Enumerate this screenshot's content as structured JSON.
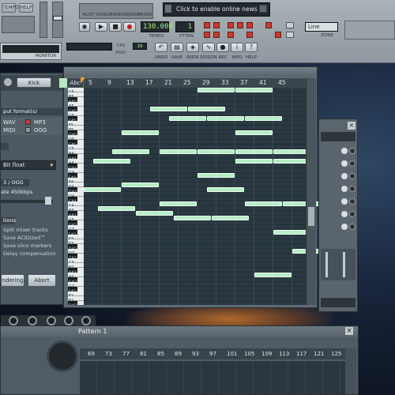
{
  "toolbar": {
    "left_menu": [
      "TEMPO",
      "HELP"
    ],
    "views": [
      "PLIST",
      "SONGR",
      "PIANO",
      "BRWSR",
      "MIXER"
    ],
    "news_text": "Click to enable online news",
    "tempo_value": "130.000",
    "tempo_label": "TEMPO",
    "pattern_label": "PTTRN",
    "pattern_value": "1",
    "snap_value": "Line",
    "snap_sub": "ZONE",
    "cpu_label": "CPU",
    "poly_label": "POLY",
    "poly_value": "16",
    "tools": [
      "UNDO",
      "SAVE",
      "RNDR",
      "EDISON",
      "REC",
      "INFO",
      "HELP"
    ],
    "recording_label": "RECORD",
    "monitor_label": "MONITOR"
  },
  "render_panel": {
    "start_button": "Kick",
    "output_header": "put format(s)",
    "formats": [
      {
        "label": "WAV",
        "checked": false
      },
      {
        "label": "MP3",
        "checked": true
      },
      {
        "label": "MIDI",
        "checked": false
      },
      {
        "label": "OGG",
        "checked": false
      }
    ],
    "depth_value": "Bit float",
    "mp3_header": "3 / OGG",
    "bitrate_text": "ate 450kbps",
    "options_header": "tions",
    "options": [
      "Split mixer tracks",
      "Save ACIDized™",
      "Save slice markers",
      "Delay compensation"
    ],
    "render_button": "ndering",
    "abort_button": "Abort"
  },
  "piano_roll": {
    "ruler": [
      "5",
      "9",
      "13",
      "17",
      "21",
      "25",
      "29",
      "33",
      "37",
      "41",
      "45"
    ],
    "keys": [
      {
        "label": "C6",
        "black": false
      },
      {
        "label": "B5",
        "black": false
      },
      {
        "label": "A#5",
        "black": true
      },
      {
        "label": "A5",
        "black": false
      },
      {
        "label": "G#5",
        "black": true
      },
      {
        "label": "G5",
        "black": false
      },
      {
        "label": "F#5",
        "black": true
      },
      {
        "label": "F5",
        "black": false
      },
      {
        "label": "E5",
        "black": false
      },
      {
        "label": "D#5",
        "black": true
      },
      {
        "label": "D5",
        "black": false
      },
      {
        "label": "C#5",
        "black": true
      },
      {
        "label": "C5",
        "black": false
      },
      {
        "label": "B4",
        "black": false
      },
      {
        "label": "A#4",
        "black": true
      },
      {
        "label": "A4",
        "black": false
      },
      {
        "label": "G#4",
        "black": true
      },
      {
        "label": "G4",
        "black": false
      },
      {
        "label": "F#4",
        "black": true
      },
      {
        "label": "F4",
        "black": false
      },
      {
        "label": "E4",
        "black": false
      },
      {
        "label": "D#4",
        "black": true
      },
      {
        "label": "D4",
        "black": false
      },
      {
        "label": "C#4",
        "black": true
      },
      {
        "label": "C4",
        "black": false
      },
      {
        "label": "B3",
        "black": false
      },
      {
        "label": "A#3",
        "black": true
      },
      {
        "label": "A3",
        "black": false
      },
      {
        "label": "G#3",
        "black": true
      },
      {
        "label": "G3",
        "black": false
      },
      {
        "label": "F#3",
        "black": true
      },
      {
        "label": "F3",
        "black": false
      },
      {
        "label": "E3",
        "black": false
      },
      {
        "label": "D#3",
        "black": true
      },
      {
        "label": "D3",
        "black": false
      },
      {
        "label": "C#3",
        "black": true
      },
      {
        "label": "C3",
        "black": false
      },
      {
        "label": "B2",
        "black": false
      },
      {
        "label": "A#2",
        "black": true
      },
      {
        "label": "A2",
        "black": false
      },
      {
        "label": "G#2",
        "black": true
      },
      {
        "label": "G2",
        "black": false
      },
      {
        "label": "F#2",
        "black": true
      },
      {
        "label": "F2",
        "black": false
      },
      {
        "label": "E2",
        "black": false
      },
      {
        "label": "D#2",
        "black": true
      }
    ],
    "notes": [
      {
        "row": 0,
        "start": 24,
        "len": 8
      },
      {
        "row": 0,
        "start": 32,
        "len": 8
      },
      {
        "row": 4,
        "start": 14,
        "len": 8
      },
      {
        "row": 4,
        "start": 22,
        "len": 8
      },
      {
        "row": 6,
        "start": 18,
        "len": 8
      },
      {
        "row": 6,
        "start": 26,
        "len": 8
      },
      {
        "row": 6,
        "start": 34,
        "len": 8
      },
      {
        "row": 9,
        "start": 8,
        "len": 8
      },
      {
        "row": 9,
        "start": 32,
        "len": 8
      },
      {
        "row": 13,
        "start": 6,
        "len": 8
      },
      {
        "row": 13,
        "start": 16,
        "len": 8
      },
      {
        "row": 13,
        "start": 24,
        "len": 8
      },
      {
        "row": 13,
        "start": 32,
        "len": 8
      },
      {
        "row": 13,
        "start": 40,
        "len": 8
      },
      {
        "row": 15,
        "start": 2,
        "len": 8
      },
      {
        "row": 15,
        "start": 32,
        "len": 8
      },
      {
        "row": 15,
        "start": 40,
        "len": 8
      },
      {
        "row": 18,
        "start": 24,
        "len": 8
      },
      {
        "row": 20,
        "start": 8,
        "len": 8
      },
      {
        "row": 21,
        "start": 0,
        "len": 8
      },
      {
        "row": 21,
        "start": 26,
        "len": 8
      },
      {
        "row": 24,
        "start": 16,
        "len": 8
      },
      {
        "row": 24,
        "start": 34,
        "len": 8
      },
      {
        "row": 24,
        "start": 42,
        "len": 8
      },
      {
        "row": 25,
        "start": 3,
        "len": 8
      },
      {
        "row": 26,
        "start": 11,
        "len": 8
      },
      {
        "row": 27,
        "start": 19,
        "len": 8
      },
      {
        "row": 27,
        "start": 27,
        "len": 8
      },
      {
        "row": 30,
        "start": 40,
        "len": 8
      },
      {
        "row": 34,
        "start": 44,
        "len": 6
      },
      {
        "row": 39,
        "start": 36,
        "len": 8
      }
    ]
  },
  "playlist": {
    "title": "Pattern 1",
    "ruler": [
      "69",
      "73",
      "77",
      "81",
      "85",
      "89",
      "93",
      "97",
      "101",
      "105",
      "109",
      "113",
      "117",
      "121",
      "125"
    ]
  }
}
